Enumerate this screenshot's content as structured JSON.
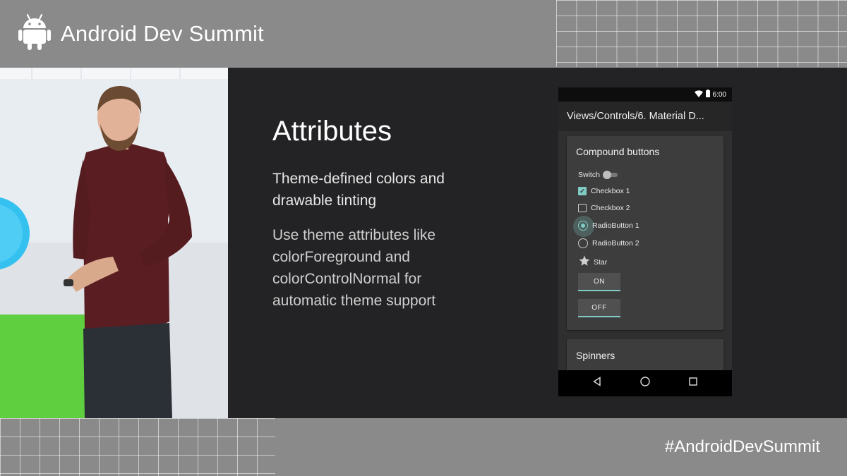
{
  "header": {
    "title": "Android Dev Summit",
    "logo_icon": "android-robot-icon"
  },
  "footer": {
    "hashtag": "#AndroidDevSummit"
  },
  "slide": {
    "title": "Attributes",
    "subtitle": "Theme-defined colors and drawable tinting",
    "body": "Use theme attributes like colorForeground and colorControlNormal for automatic theme support"
  },
  "phone": {
    "status": {
      "time": "6:00",
      "icons": [
        "wifi-icon",
        "battery-icon"
      ]
    },
    "appbar_title": "Views/Controls/6. Material D...",
    "card_compound": {
      "title": "Compound buttons",
      "switch_label": "Switch",
      "checkbox1": "Checkbox 1",
      "checkbox2": "Checkbox 2",
      "radio1": "RadioButton 1",
      "radio2": "RadioButton 2",
      "star": "Star",
      "toggle_on": "ON",
      "toggle_off": "OFF"
    },
    "card_spinners": {
      "title": "Spinners"
    },
    "nav": [
      "back-icon",
      "home-icon",
      "recents-icon"
    ]
  },
  "colors": {
    "accent": "#80cbc4",
    "slide_background": "#232325",
    "frame_background": "#8a8a8a"
  }
}
